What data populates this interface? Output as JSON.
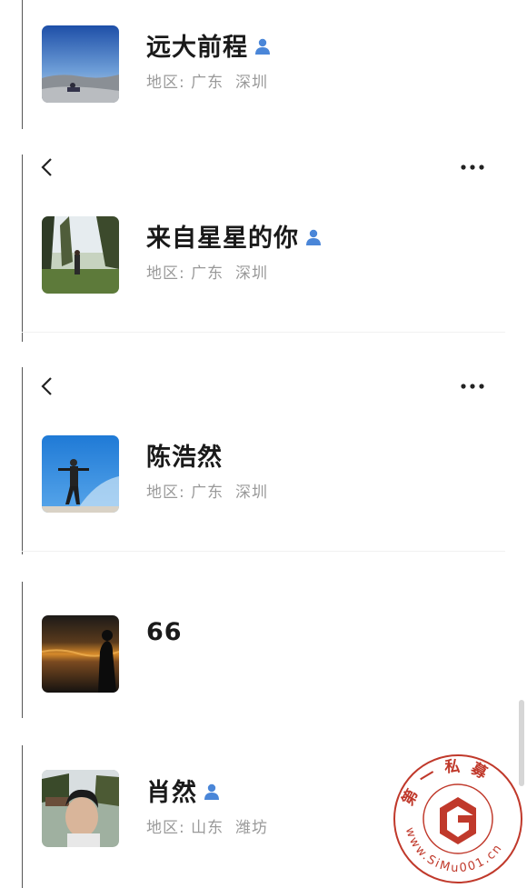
{
  "icons": {
    "back": "chevron-left-icon",
    "more": "more-dots-icon",
    "verified": "person-verified-icon"
  },
  "colors": {
    "verified": "#4a86d8",
    "region_text": "#9a9a9a",
    "watermark": "#c0392b"
  },
  "profiles": [
    {
      "name": "远大前程",
      "verified": true,
      "region_label": "地区:",
      "province": "广东",
      "city": "深圳"
    },
    {
      "name": "来自星星的你",
      "verified": true,
      "region_label": "地区:",
      "province": "广东",
      "city": "深圳"
    },
    {
      "name": "陈浩然",
      "verified": false,
      "region_label": "地区:",
      "province": "广东",
      "city": "深圳"
    },
    {
      "name": "66",
      "verified": false
    },
    {
      "name": "肖然",
      "verified": true,
      "region_label": "地区:",
      "province": "山东",
      "city": "潍坊"
    }
  ],
  "watermark": {
    "title": "第一私募",
    "url": "www.SiMu001.cn"
  }
}
